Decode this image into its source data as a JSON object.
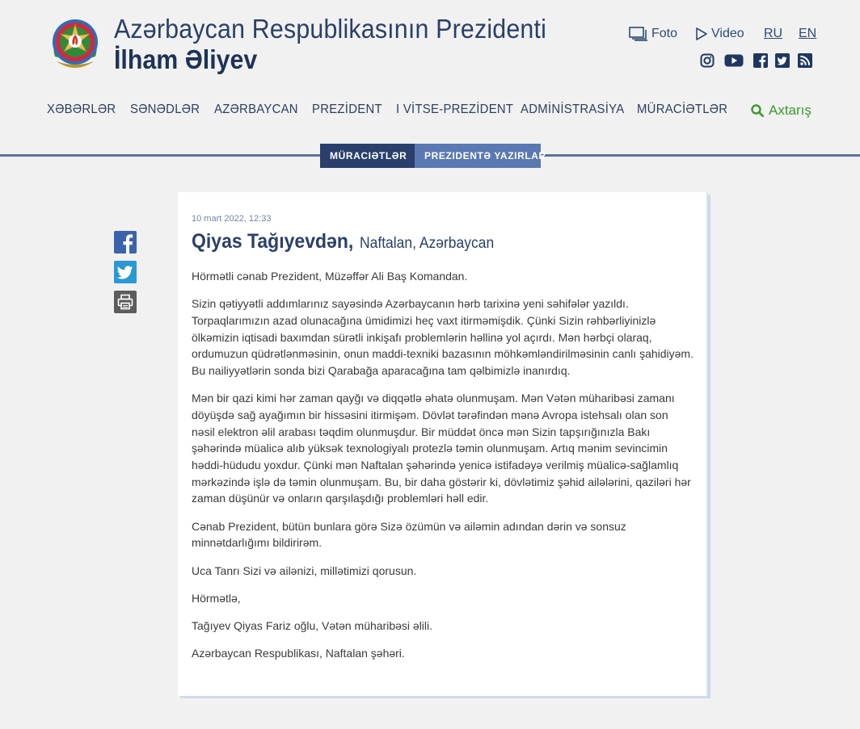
{
  "header": {
    "title_line1": "Azərbaycan Respublikasının Prezidenti",
    "title_line2": "İlham Əliyev",
    "emblem_icon": "state-emblem-icon"
  },
  "toplinks": {
    "foto": "Foto",
    "video": "Video",
    "ru": "RU",
    "en": "EN"
  },
  "social": [
    "instagram-icon",
    "youtube-icon",
    "facebook-icon",
    "twitter-icon",
    "rss-icon"
  ],
  "nav": {
    "items": [
      "XƏBƏRLƏR",
      "SƏNƏDLƏR",
      "AZƏRBAYCAN",
      "PREZİDENT",
      "I VİTSE-PREZİDENT",
      "ADMİNİSTRASİYA",
      "MÜRACİƏTLƏR"
    ],
    "search": "Axtarış"
  },
  "breadcrumbs": [
    "Müraciətlər",
    "Prezidentə yazırlar"
  ],
  "letter": {
    "date": "10 mart 2022, 12:33",
    "author": "Qiyas Tağıyevdən,",
    "place": "Naftalan, Azərbaycan",
    "paragraphs": [
      "Hörmətli cənab Prezident, Müzəffər Ali Baş Komandan.",
      "Sizin qətiyyətli addımlarınız sayəsində Azərbaycanın hərb tarixinə yeni səhifələr yazıldı. Torpaqlarımızın azad olunacağına ümidimizi heç vaxt itirməmişdik. Çünki Sizin rəhbərliyinizlə ölkəmizin iqtisadi baxımdan sürətli inkişafı problemlərin həllinə yol açırdı. Mən hərbçi olaraq, ordumuzun qüdrətlənməsinin, onun maddi-texniki bazasının möhkəmləndirilməsinin canlı şahidiyəm. Bu nailiyyətlərin sonda bizi Qarabağa aparacağına tam qəlbimizlə inanırdıq.",
      "Mən bir qazi kimi hər zaman qayğı və diqqətlə əhatə olunmuşam. Mən Vətən müharibəsi zamanı döyüşdə sağ ayağımın bir hissəsini itirmişəm. Dövlət tərəfindən mənə Avropa istehsalı olan son nəsil elektron əlil arabası təqdim olunmuşdur. Bir müddət öncə mən Sizin tapşırığınızla Bakı şəhərində müalicə alıb yüksək texnologiyalı protezlə təmin olunmuşam. Artıq mənim sevincimin həddi-hüdudu yoxdur. Çünki mən Naftalan şəhərində yenicə istifadəyə verilmiş müalicə-sağlamlıq mərkəzində işlə də təmin olunmuşam. Bu, bir daha göstərir ki, dövlətimiz şəhid ailələrini, qaziləri hər zaman düşünür və onların qarşılaşdığı problemləri həll edir.",
      "Cənab Prezident, bütün bunlara görə Sizə özümün və ailəmin adından dərin və sonsuz minnətdarlığımı bildirirəm.",
      "Uca Tanrı Sizi və ailənizi, millətimizi qorusun.",
      "Hörmətlə,",
      "Tağıyev Qiyas Fariz oğlu, Vətən müharibəsi əlili.",
      "Azərbaycan Respublikası, Naftalan şəhəri."
    ]
  },
  "share": [
    "facebook-share-icon",
    "twitter-share-icon",
    "print-icon"
  ],
  "colors": {
    "title": "#2a4068",
    "search": "#3c9a2e",
    "divider": "#5b7199",
    "crumb_dark": "#2a3f6b",
    "crumb_light": "#5a78b1",
    "facebook": "#3b63ad",
    "twitter": "#2a97d6"
  }
}
